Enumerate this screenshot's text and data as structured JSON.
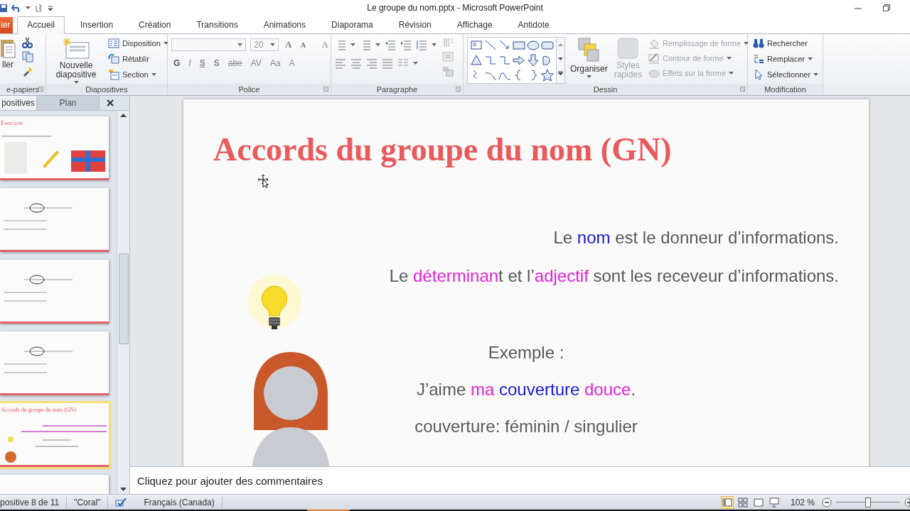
{
  "window": {
    "title": "Le groupe du nom.pptx  -  Microsoft PowerPoint"
  },
  "tabs": [
    {
      "label": "ier",
      "kind": "file",
      "selected": false
    },
    {
      "label": "Accueil",
      "kind": "tab",
      "selected": true
    },
    {
      "label": "Insertion",
      "kind": "tab",
      "selected": false
    },
    {
      "label": "Création",
      "kind": "tab",
      "selected": false
    },
    {
      "label": "Transitions",
      "kind": "tab",
      "selected": false
    },
    {
      "label": "Animations",
      "kind": "tab",
      "selected": false
    },
    {
      "label": "Diaporama",
      "kind": "tab",
      "selected": false
    },
    {
      "label": "Révision",
      "kind": "tab",
      "selected": false
    },
    {
      "label": "Affichage",
      "kind": "tab",
      "selected": false
    },
    {
      "label": "Antidote",
      "kind": "tab",
      "selected": false
    }
  ],
  "ribbon": [
    {
      "kind": "clipboard",
      "label": "e-papiers",
      "paste": "ller"
    },
    {
      "kind": "slides",
      "label": "Diapositives",
      "new_slide": "Nouvelle diapositive",
      "commands": [
        "Disposition",
        "Rétablir",
        "Section"
      ]
    },
    {
      "kind": "font",
      "label": "Police",
      "font_size": "20",
      "row1": [
        "A",
        "A",
        "A"
      ],
      "row2": [
        "G",
        "I",
        "S",
        "S",
        "abe",
        "AV",
        "Aa",
        "A"
      ]
    },
    {
      "kind": "paragraph",
      "label": "Paragraphe"
    },
    {
      "kind": "drawing",
      "label": "Dessin",
      "arrange": "Organiser",
      "quick_styles": "Styles rapides",
      "commands": [
        {
          "label": "Remplissage de forme",
          "disabled": true
        },
        {
          "label": "Contour de forme",
          "disabled": true
        },
        {
          "label": "Effets sur la forme",
          "disabled": true
        }
      ]
    },
    {
      "kind": "editing",
      "label": "Modification",
      "commands": [
        "Rechercher",
        "Remplacer",
        "Sélectionner"
      ]
    }
  ],
  "panel": {
    "tabs": [
      {
        "label": "positives",
        "selected": true
      },
      {
        "label": "Plan",
        "selected": false
      }
    ],
    "thumbnails": [
      {
        "title": "Exercices",
        "kind": "exercise",
        "selected": false
      },
      {
        "kind": "text",
        "selected": false
      },
      {
        "kind": "text",
        "selected": false
      },
      {
        "kind": "text",
        "selected": false
      },
      {
        "title": "Accords du groupe du nom (GN)",
        "kind": "current",
        "selected": true
      },
      {
        "kind": "partial",
        "selected": false
      }
    ]
  },
  "slide": {
    "title": "Accords du groupe du nom (GN)",
    "sentences": [
      [
        {
          "text": "Le "
        },
        {
          "text": "nom",
          "color": "#1a1ad6"
        },
        {
          "text": " est le donneur d’informations."
        }
      ],
      [
        {
          "text": "Le "
        },
        {
          "text": "déterminan",
          "color": "#e023d8"
        },
        {
          "text": "t et l’"
        },
        {
          "text": "adjectif",
          "color": "#e023d8"
        },
        {
          "text": " sont les receveur d’informations."
        }
      ]
    ],
    "example_label": "Exemple :",
    "example": [
      {
        "text": "J’aime "
      },
      {
        "text": "ma",
        "color": "#e023d8"
      },
      {
        "text": " couverture",
        "color": "#1a1ad6"
      },
      {
        "text": " douce",
        "color": "#e023d8"
      },
      {
        "text": "."
      }
    ],
    "analysis": "couverture: féminin / singulier"
  },
  "notes": {
    "placeholder": "Cliquez pour ajouter des commentaires"
  },
  "status_bar": {
    "slide": "positive 8 de 11",
    "theme": "\"Coral\"",
    "language": "Français (Canada)",
    "views": [
      {
        "selected": true
      },
      {
        "selected": false
      },
      {
        "selected": false
      },
      {
        "selected": false
      }
    ],
    "zoom": "102 %",
    "zoom_level": {
      "level": 0.5
    }
  }
}
